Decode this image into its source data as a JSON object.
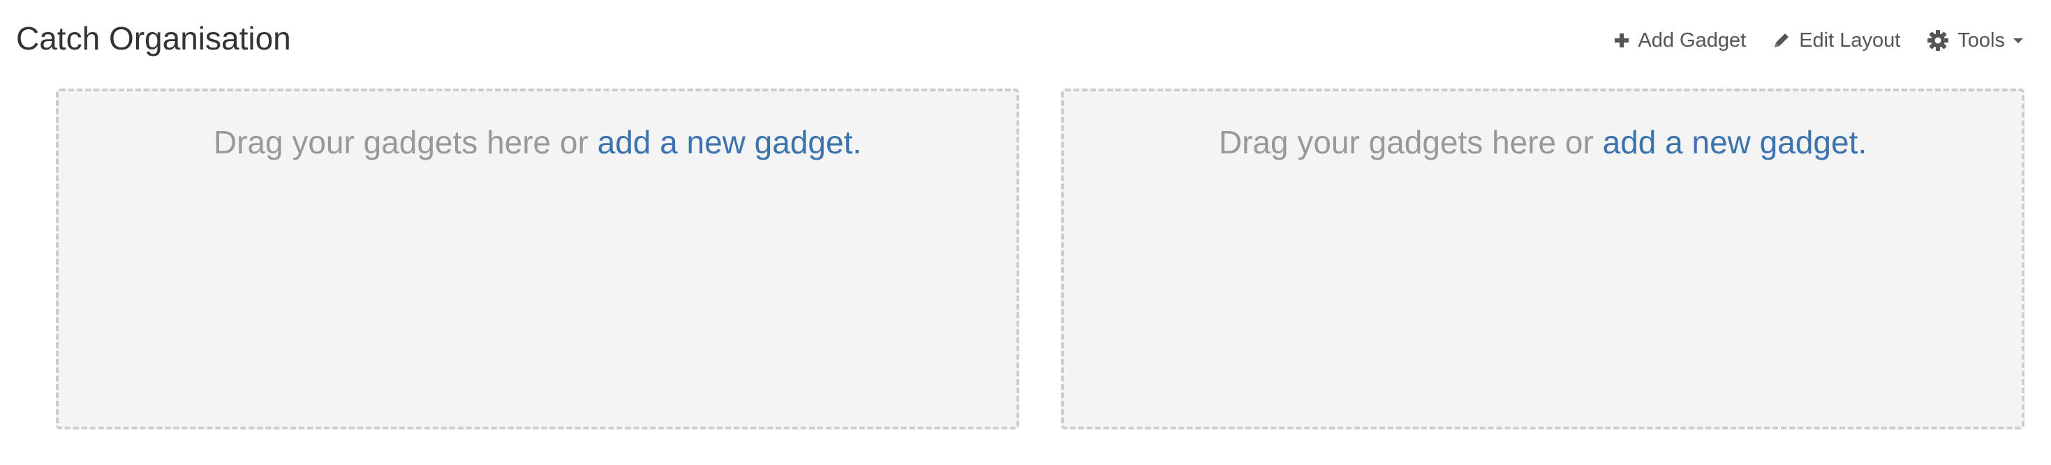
{
  "header": {
    "title": "Catch Organisation"
  },
  "toolbar": {
    "add_gadget_label": "Add Gadget",
    "edit_layout_label": "Edit Layout",
    "tools_label": "Tools",
    "icons": {
      "add_gadget": "plus-icon",
      "edit_layout": "pencil-icon",
      "tools": "gear-icon",
      "tools_dropdown": "caret-down-icon"
    }
  },
  "columns": [
    {
      "prompt_text": "Drag your gadgets here or ",
      "link_text": "add a new gadget."
    },
    {
      "prompt_text": "Drag your gadgets here or ",
      "link_text": "add a new gadget."
    }
  ],
  "colors": {
    "link": "#3b73af",
    "prompt_text": "#999999",
    "column_background": "#f4f4f4",
    "column_border": "#cccccc"
  }
}
